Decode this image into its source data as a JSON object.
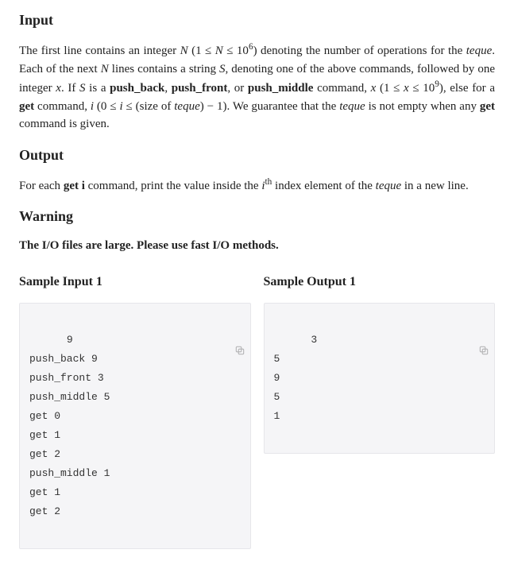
{
  "sections": {
    "input": {
      "heading": "Input",
      "p_html": "The first line contains an integer <span class='math'>N</span> (1 ≤ <span class='math'>N</span> ≤ 10<sup>6</sup>) denoting the number of operations for the <span class='i'>teque</span>. Each of the next <span class='math'>N</span> lines contains a string <span class='math'>S</span>, denoting one of the above commands, followed by one integer <span class='math'>x</span>. If <span class='math'>S</span> is a <span class='b'>push_back</span>, <span class='b'>push_front</span>, or <span class='b'>push_middle</span> command, <span class='math'>x</span> (1 ≤ <span class='math'>x</span> ≤ 10<sup>9</sup>), else for a <span class='b'>get</span> command, <span class='math'>i</span> (0 ≤ <span class='math'>i</span> ≤ (size of <span class='i'>teque</span>) − 1). We guarantee that the <span class='i'>teque</span> is not empty when any <span class='b'>get</span> command is given."
    },
    "output": {
      "heading": "Output",
      "p_html": "For each <span class='b'>get i</span> command, print the value inside the <span class='math'>i</span><sup>th</sup> index element of the <span class='i'>teque</span> in a new line."
    },
    "warning": {
      "heading": "Warning",
      "line": "The I/O files are large. Please use fast I/O methods."
    }
  },
  "samples": {
    "input": {
      "title": "Sample Input 1",
      "text": "9\npush_back 9\npush_front 3\npush_middle 5\nget 0\nget 1\nget 2\npush_middle 1\nget 1\nget 2"
    },
    "output": {
      "title": "Sample Output 1",
      "text": "3\n5\n9\n5\n1"
    }
  },
  "icons": {
    "copy": "copy-icon"
  }
}
